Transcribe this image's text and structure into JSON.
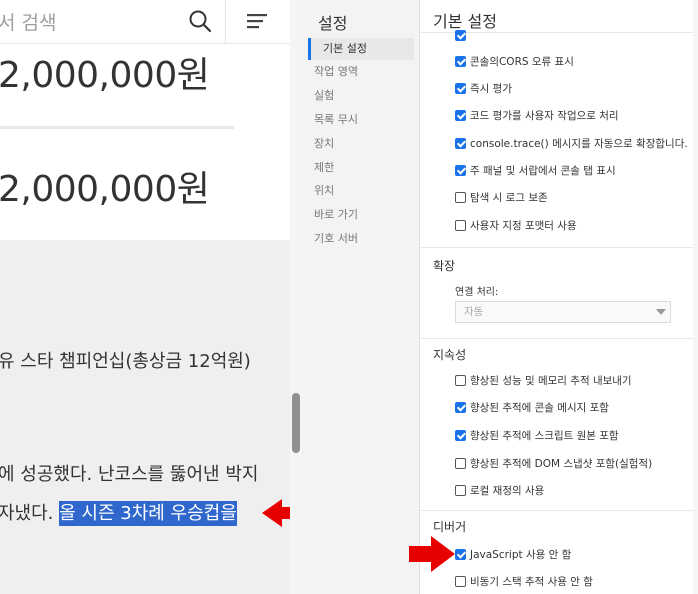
{
  "webpage": {
    "search": {
      "placeholder": "서 검색"
    },
    "prices": [
      "2,000,000원",
      "2,000,000원"
    ],
    "article": {
      "line1": "유 스타 챔피언십(총상금 12억원)",
      "line2": "에 성공했다. 난코스를 뚫어낸 박지",
      "line3_plain": "자냈다. ",
      "line3_highlight": "올 시즌 3차례 우승컵을"
    },
    "highlight_color": "#2f67cc",
    "annotation_color": "#e60000"
  },
  "settings_nav": {
    "title": "설정",
    "items": [
      {
        "label": "기본 설정",
        "active": true
      },
      {
        "label": "작업 영역",
        "active": false
      },
      {
        "label": "실험",
        "active": false
      },
      {
        "label": "목록 무시",
        "active": false
      },
      {
        "label": "장치",
        "active": false
      },
      {
        "label": "제한",
        "active": false
      },
      {
        "label": "위치",
        "active": false
      },
      {
        "label": "바로 가기",
        "active": false
      },
      {
        "label": "기호 서버",
        "active": false
      }
    ]
  },
  "settings_main": {
    "title": "기본 설정",
    "console_items": [
      {
        "label": "콘솔의CORS 오류 표시",
        "checked": true
      },
      {
        "label": "즉시 평가",
        "checked": true
      },
      {
        "label": "코드 평가를 사용자 작업으로 처리",
        "checked": true
      },
      {
        "label": "console.trace() 메시지를 자동으로 확장합니다.",
        "checked": true
      },
      {
        "label": "주 패널 및 서랍에서 콘솔 탭 표시",
        "checked": true
      },
      {
        "label": "탐색 시 로그 보존",
        "checked": false
      },
      {
        "label": "사용자 지정 포맷터 사용",
        "checked": false
      }
    ],
    "extensions": {
      "title": "확장",
      "link_handling_label": "연결 처리:",
      "link_handling_value": "자동"
    },
    "persistence": {
      "title": "지속성",
      "items": [
        {
          "label": "향상된 성능 및 메모리 추적 내보내기",
          "checked": false
        },
        {
          "label": "향상된 추적에 콘솔 메시지 포함",
          "checked": true
        },
        {
          "label": "향상된 추적에 스크립트 원본 포함",
          "checked": true
        },
        {
          "label": "향상된 추적에 DOM 스냅샷 포함(실험적)",
          "checked": false
        },
        {
          "label": "로컬 재정의 사용",
          "checked": false
        }
      ]
    },
    "debugger": {
      "title": "디버거",
      "items": [
        {
          "label": "JavaScript 사용 안 함",
          "checked": true
        },
        {
          "label": "비동기 스택 추적 사용 안 함",
          "checked": false
        }
      ]
    }
  }
}
